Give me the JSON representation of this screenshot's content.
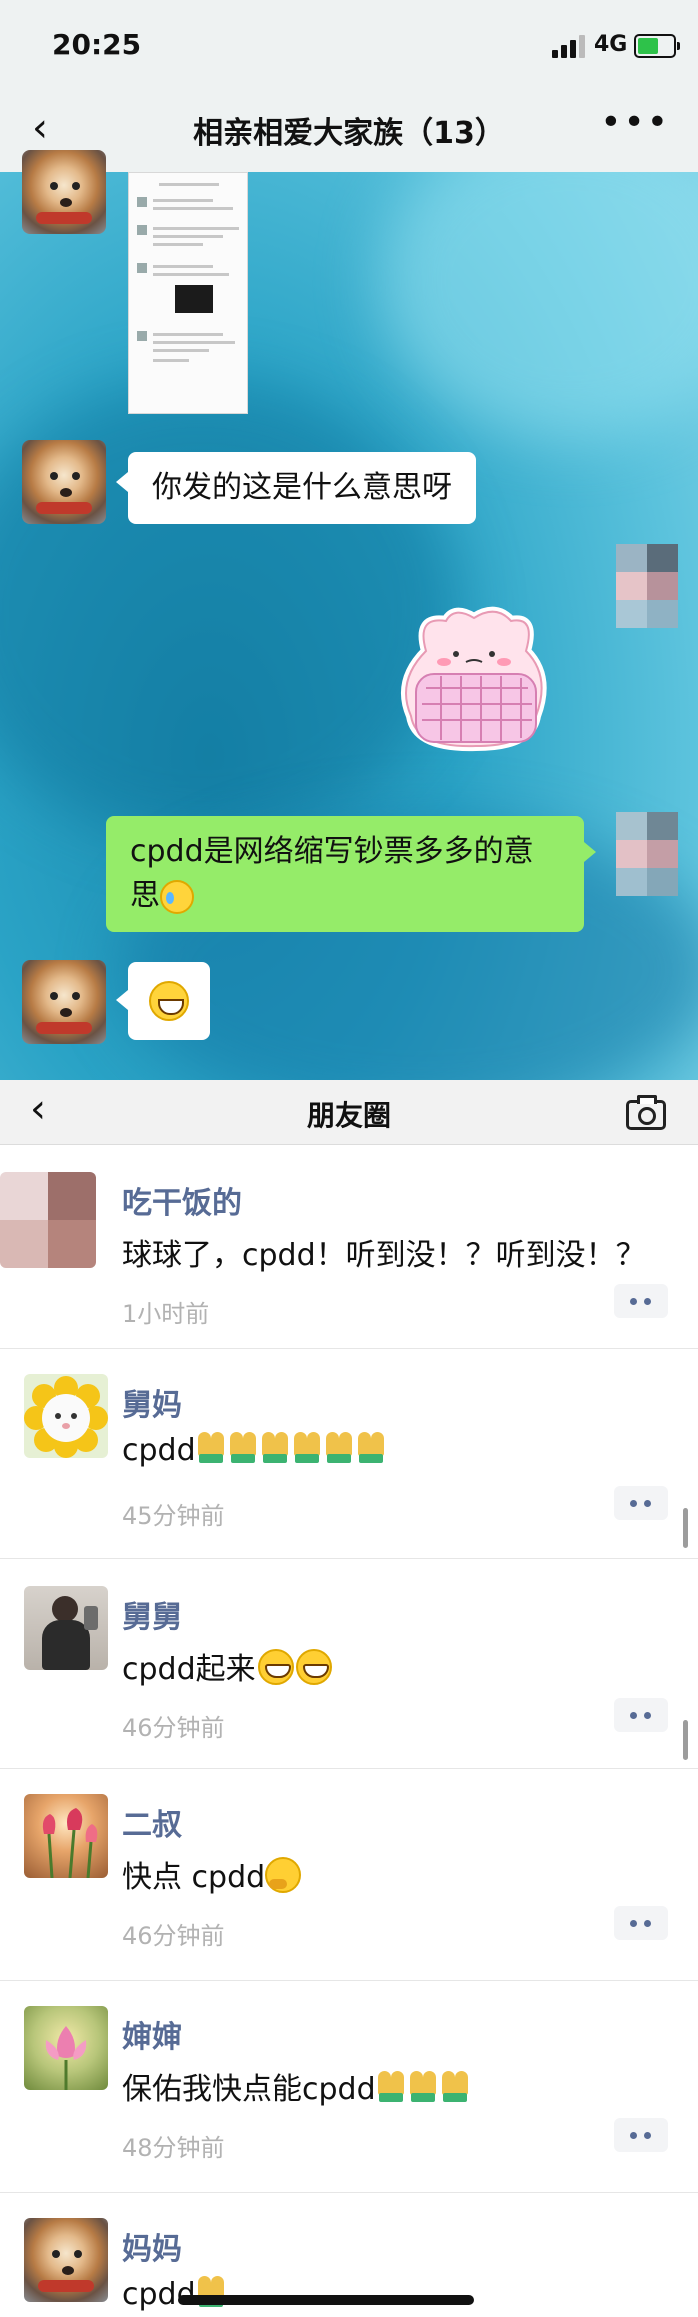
{
  "status_bar": {
    "time": "20:25",
    "network": "4G"
  },
  "chat": {
    "title": "相亲相爱大家族（13）",
    "messages": [
      {
        "side": "left",
        "kind": "image"
      },
      {
        "side": "left",
        "kind": "text",
        "text": "你发的这是什么意思呀"
      },
      {
        "side": "right",
        "kind": "sticker"
      },
      {
        "side": "right",
        "kind": "text",
        "line1": "cpdd是网络缩写钞票多多的意",
        "line2": "思"
      },
      {
        "side": "left",
        "kind": "emoji"
      }
    ]
  },
  "moments": {
    "title": "朋友圈",
    "posts": [
      {
        "name": "吃干饭的",
        "content": "球球了，cpdd！听到没！？听到没！？",
        "time": "1小时前"
      },
      {
        "name": "舅妈",
        "content": "cpdd",
        "time": "45分钟前",
        "emoji": "pray-x6"
      },
      {
        "name": "舅舅",
        "content": "cpdd起来",
        "time": "46分钟前",
        "emoji": "grin-x2"
      },
      {
        "name": "二叔",
        "content": "快点 cpdd",
        "time": "46分钟前",
        "emoji": "thinking"
      },
      {
        "name": "婶婶",
        "content": "保佑我快点能cpdd",
        "time": "48分钟前",
        "emoji": "pray-x3"
      },
      {
        "name": "妈妈",
        "content": "cpdd",
        "emoji": "pray-x1"
      }
    ]
  },
  "colors": {
    "link_name": "#576b95",
    "chat_bubble_green": "#95ec69",
    "timestamp_gray": "#b2b2b2"
  }
}
